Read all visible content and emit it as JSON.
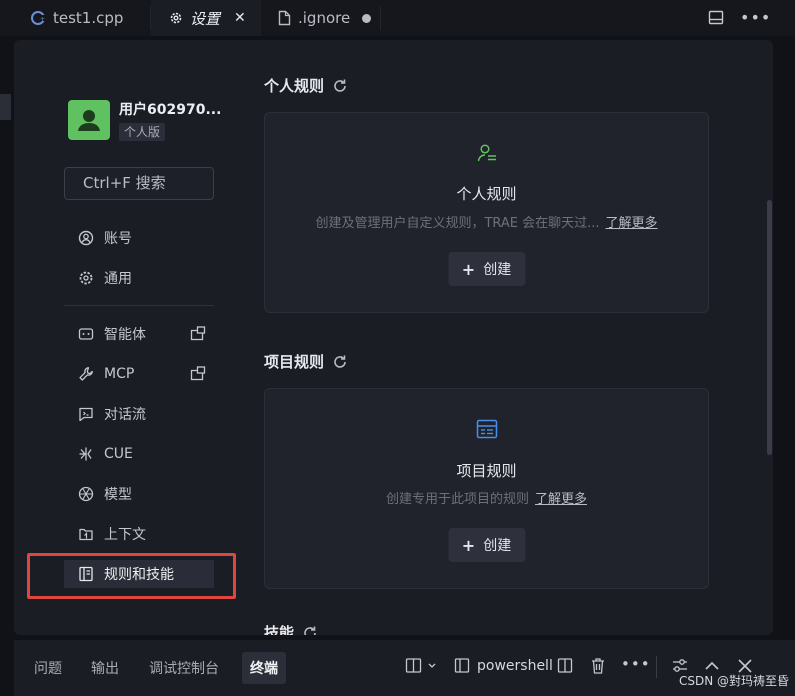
{
  "tabs": [
    {
      "label": "test1.cpp",
      "icon": "cpp-file-icon"
    },
    {
      "label": "设置",
      "icon": "gear-icon",
      "active": true
    },
    {
      "label": ".ignore",
      "icon": "file-icon",
      "unsaved": true
    }
  ],
  "user": {
    "name": "用户602970...",
    "plan": "个人版"
  },
  "search": {
    "placeholder": "Ctrl+F 搜索"
  },
  "nav": {
    "group1": [
      {
        "label": "账号",
        "icon": "account-icon"
      },
      {
        "label": "通用",
        "icon": "gear-icon"
      }
    ],
    "group2": [
      {
        "label": "智能体",
        "icon": "agent-icon",
        "external": true
      },
      {
        "label": "MCP",
        "icon": "wrench-icon",
        "external": true
      },
      {
        "label": "对话流",
        "icon": "chat-icon"
      },
      {
        "label": "CUE",
        "icon": "cue-icon"
      },
      {
        "label": "模型",
        "icon": "model-icon"
      },
      {
        "label": "上下文",
        "icon": "context-icon"
      },
      {
        "label": "规则和技能",
        "icon": "rules-icon",
        "active": true
      }
    ]
  },
  "sections": {
    "personal": {
      "title": "个人规则",
      "card_title": "个人规则",
      "desc": "创建及管理用户自定义规则，TRAE 会在聊天过...",
      "learn_more": "了解更多",
      "create": "创建"
    },
    "project": {
      "title": "项目规则",
      "card_title": "项目规则",
      "desc": "创建专用于此项目的规则",
      "learn_more": "了解更多",
      "create": "创建"
    },
    "skills": {
      "title": "技能"
    }
  },
  "bottom_tabs": [
    {
      "label": "问题"
    },
    {
      "label": "输出"
    },
    {
      "label": "调试控制台"
    },
    {
      "label": "终端",
      "active": true
    }
  ],
  "terminal": {
    "shell": "powershell"
  },
  "watermark": "CSDN @對玛祷至昏",
  "colors": {
    "accent_green": "#5fc15f",
    "accent_blue": "#4a8fe7",
    "highlight_red": "#e0453e"
  }
}
